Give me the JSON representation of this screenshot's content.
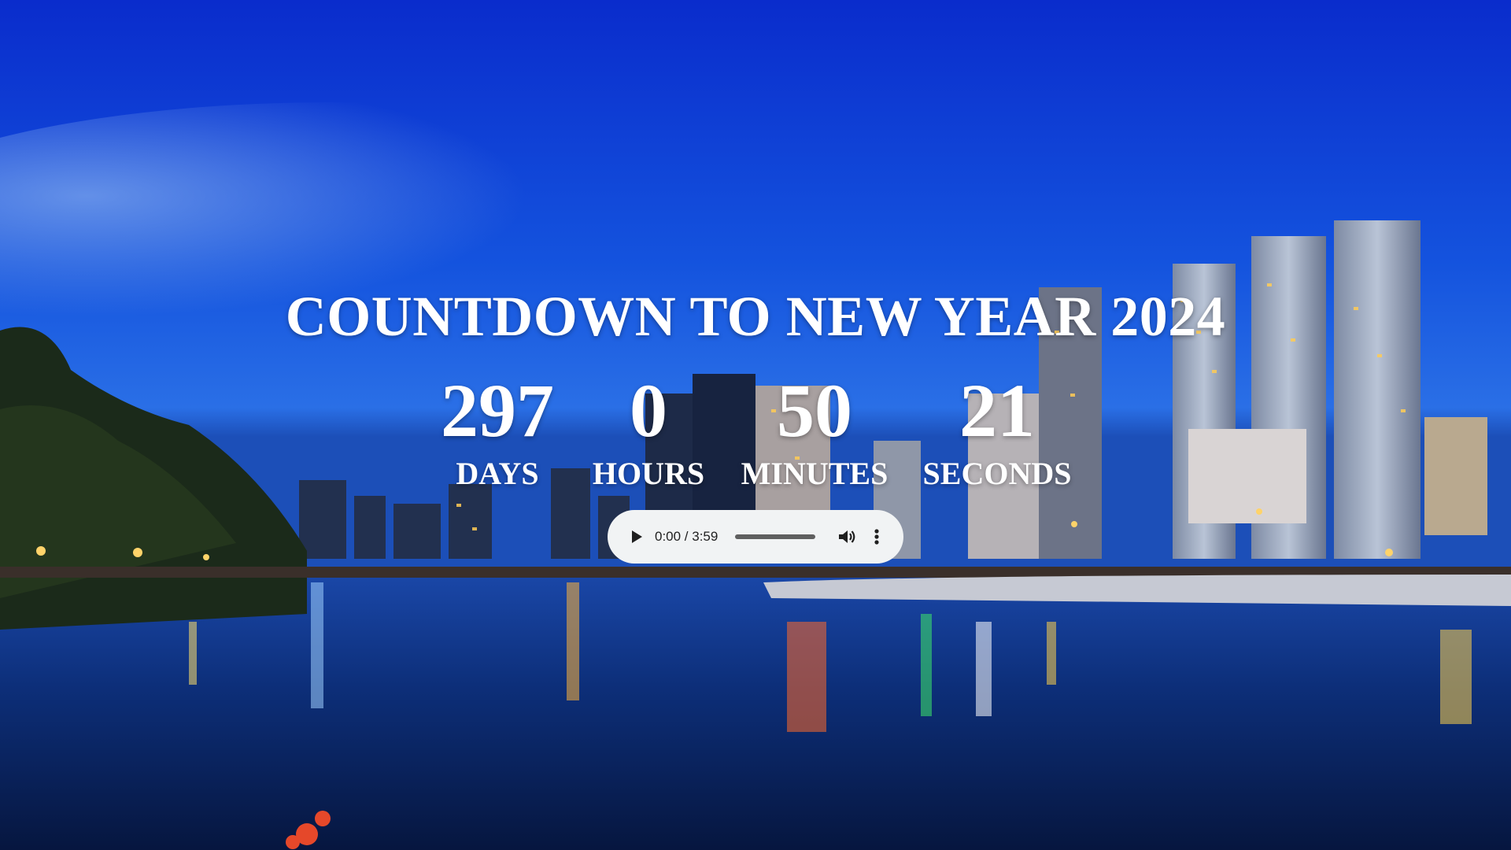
{
  "page": {
    "title": "COUNTDOWN TO NEW YEAR 2024"
  },
  "countdown": [
    {
      "value": "297",
      "label": "DAYS"
    },
    {
      "value": "0",
      "label": "HOURS"
    },
    {
      "value": "50",
      "label": "MINUTES"
    },
    {
      "value": "21",
      "label": "SECONDS"
    }
  ],
  "audio_player": {
    "time": "0:00 / 3:59",
    "progress": 0,
    "icons": [
      "play-icon",
      "volume-icon",
      "more-options-icon"
    ]
  },
  "background": {
    "description_icon": "city-skyline-night-photo",
    "sky_top": "#0a2fd0",
    "sky_mid": "#1556e0",
    "water": "#0b2a6b"
  }
}
